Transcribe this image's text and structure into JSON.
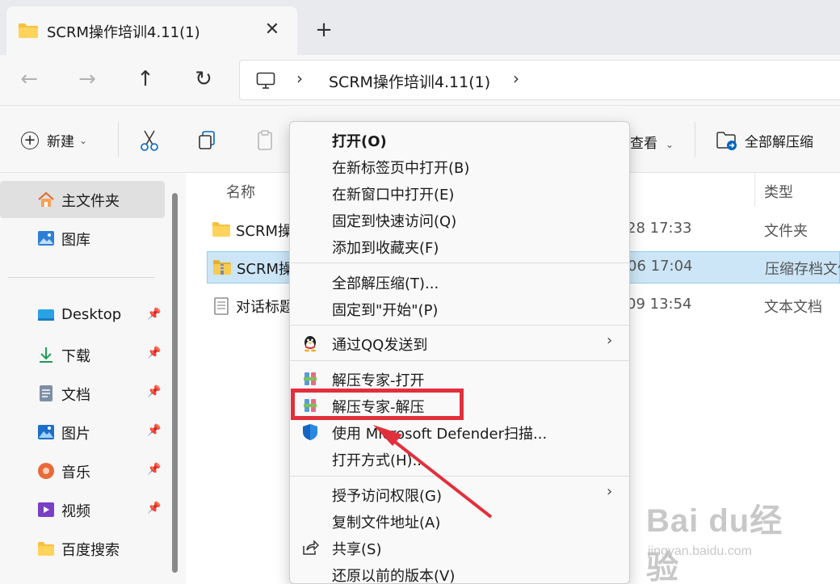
{
  "tab": {
    "title": "SCRM操作培训4.11(1)",
    "close": "✕",
    "new_tab": "+"
  },
  "address": {
    "path": "SCRM操作培训4.11(1)",
    "chevron": "›"
  },
  "nav": {
    "back": "←",
    "forward": "→",
    "up": "↑",
    "refresh": "↻"
  },
  "toolbar": {
    "new_label": "新建",
    "view_label": "查看",
    "extract_all_label": "全部解压缩",
    "dropdown": "⌄"
  },
  "sidebar": {
    "items": [
      {
        "label": "主文件夹",
        "icon": "home-icon"
      },
      {
        "label": "图库",
        "icon": "gallery-icon"
      },
      {
        "label": "Desktop",
        "icon": "desktop-icon"
      },
      {
        "label": "下载",
        "icon": "download-icon"
      },
      {
        "label": "文档",
        "icon": "document-icon"
      },
      {
        "label": "图片",
        "icon": "pictures-icon"
      },
      {
        "label": "音乐",
        "icon": "music-icon"
      },
      {
        "label": "视频",
        "icon": "video-icon"
      },
      {
        "label": "百度搜索",
        "icon": "folder-icon"
      }
    ],
    "pin": "📌"
  },
  "list": {
    "columns": {
      "name": "名称",
      "type": "类型"
    },
    "rows": [
      {
        "name": "SCRM操",
        "date": "28 17:33",
        "type": "文件夹"
      },
      {
        "name": "SCRM操",
        "date": "06 17:04",
        "type": "压缩存档文件"
      },
      {
        "name": "对话标题",
        "date": "09 13:54",
        "type": "文本文档"
      }
    ]
  },
  "context_menu": {
    "items": [
      {
        "label": "打开(O)"
      },
      {
        "label": "在新标签页中打开(B)"
      },
      {
        "label": "在新窗口中打开(E)"
      },
      {
        "label": "固定到快速访问(Q)"
      },
      {
        "label": "添加到收藏夹(F)"
      },
      {
        "label": "全部解压缩(T)..."
      },
      {
        "label": "固定到\"开始\"(P)"
      },
      {
        "label": "通过QQ发送到"
      },
      {
        "label": "解压专家-打开"
      },
      {
        "label": "解压专家-解压"
      },
      {
        "label": "使用 Microsoft Defender扫描..."
      },
      {
        "label": "打开方式(H)..."
      },
      {
        "label": "授予访问权限(G)"
      },
      {
        "label": "复制文件地址(A)"
      },
      {
        "label": "共享(S)"
      },
      {
        "label": "还原以前的版本(V)"
      }
    ],
    "submenu_arrow": "›"
  },
  "watermark": {
    "brand": "Bai du经验",
    "sub": "jingyan.baidu.com"
  },
  "colors": {
    "highlight": "#e1303b",
    "selection": "#cce6f7",
    "accent": "#0067c0",
    "folder": "#f4c23d"
  }
}
